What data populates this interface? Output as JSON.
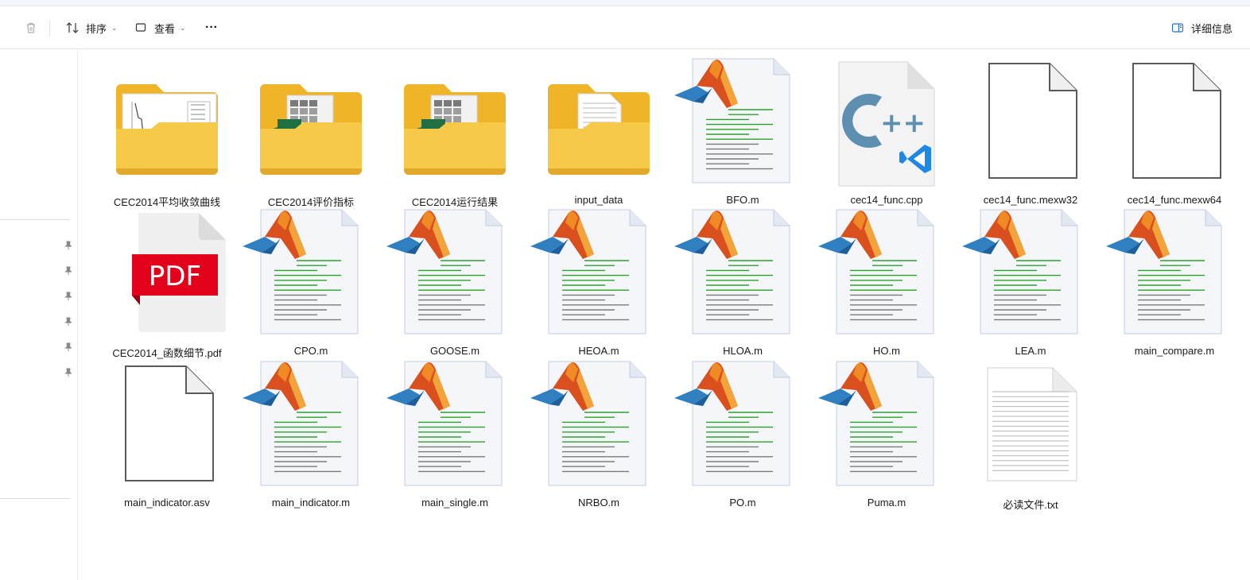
{
  "toolbar": {
    "sort_label": "排序",
    "view_label": "查看",
    "more_label": "···",
    "details_label": "详细信息"
  },
  "files": [
    {
      "name": "CEC2014平均收敛曲线",
      "kind": "folder-chart"
    },
    {
      "name": "CEC2014评价指标",
      "kind": "folder-excel"
    },
    {
      "name": "CEC2014运行结果",
      "kind": "folder-excel"
    },
    {
      "name": "input_data",
      "kind": "folder-doc"
    },
    {
      "name": "BFO.m",
      "kind": "matlab"
    },
    {
      "name": "cec14_func.cpp",
      "kind": "cpp"
    },
    {
      "name": "cec14_func.mexw32",
      "kind": "blank"
    },
    {
      "name": "cec14_func.mexw64",
      "kind": "blank"
    },
    {
      "name": "CEC2014_函数细节.pdf",
      "kind": "pdf"
    },
    {
      "name": "CPO.m",
      "kind": "matlab"
    },
    {
      "name": "GOOSE.m",
      "kind": "matlab"
    },
    {
      "name": "HEOA.m",
      "kind": "matlab"
    },
    {
      "name": "HLOA.m",
      "kind": "matlab"
    },
    {
      "name": "HO.m",
      "kind": "matlab"
    },
    {
      "name": "LEA.m",
      "kind": "matlab"
    },
    {
      "name": "main_compare.m",
      "kind": "matlab"
    },
    {
      "name": "main_indicator.asv",
      "kind": "blank"
    },
    {
      "name": "main_indicator.m",
      "kind": "matlab"
    },
    {
      "name": "main_single.m",
      "kind": "matlab"
    },
    {
      "name": "NRBO.m",
      "kind": "matlab"
    },
    {
      "name": "PO.m",
      "kind": "matlab"
    },
    {
      "name": "Puma.m",
      "kind": "matlab"
    },
    {
      "name": "必读文件.txt",
      "kind": "txt"
    }
  ],
  "pdf_badge": "PDF",
  "colors": {
    "folder": "#f7c948",
    "folder_back": "#f0b429",
    "pdf_red": "#e2001a",
    "cpp_blue": "#5c8fb0",
    "vscode_blue": "#1e88e5"
  }
}
